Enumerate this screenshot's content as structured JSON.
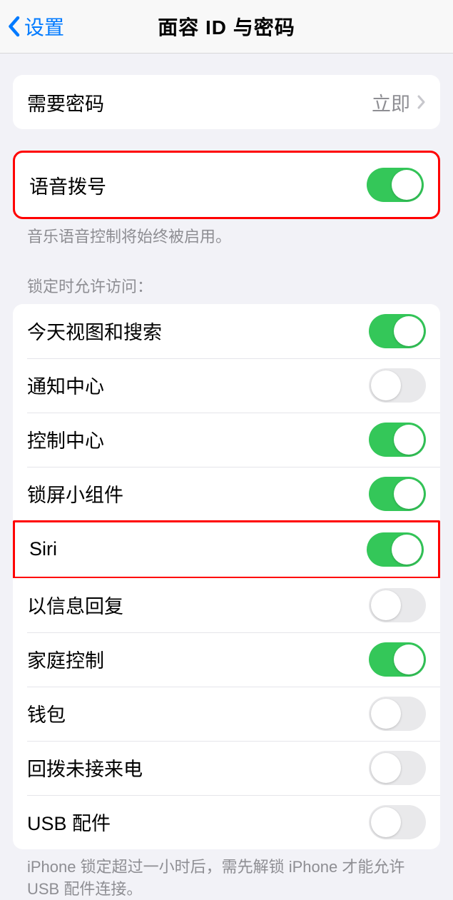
{
  "navbar": {
    "back_label": "设置",
    "title": "面容 ID 与密码"
  },
  "require_passcode": {
    "label": "需要密码",
    "value": "立即"
  },
  "voice_dial": {
    "label": "语音拨号",
    "footer": "音乐语音控制将始终被启用。"
  },
  "locked_access": {
    "header": "锁定时允许访问：",
    "items": [
      {
        "label": "今天视图和搜索",
        "on": true
      },
      {
        "label": "通知中心",
        "on": false
      },
      {
        "label": "控制中心",
        "on": true
      },
      {
        "label": "锁屏小组件",
        "on": true
      },
      {
        "label": "Siri",
        "on": true
      },
      {
        "label": "以信息回复",
        "on": false
      },
      {
        "label": "家庭控制",
        "on": true
      },
      {
        "label": "钱包",
        "on": false
      },
      {
        "label": "回拨未接来电",
        "on": false
      },
      {
        "label": "USB 配件",
        "on": false
      }
    ],
    "footer": "iPhone 锁定超过一小时后，需先解锁 iPhone 才能允许 USB 配件连接。"
  }
}
